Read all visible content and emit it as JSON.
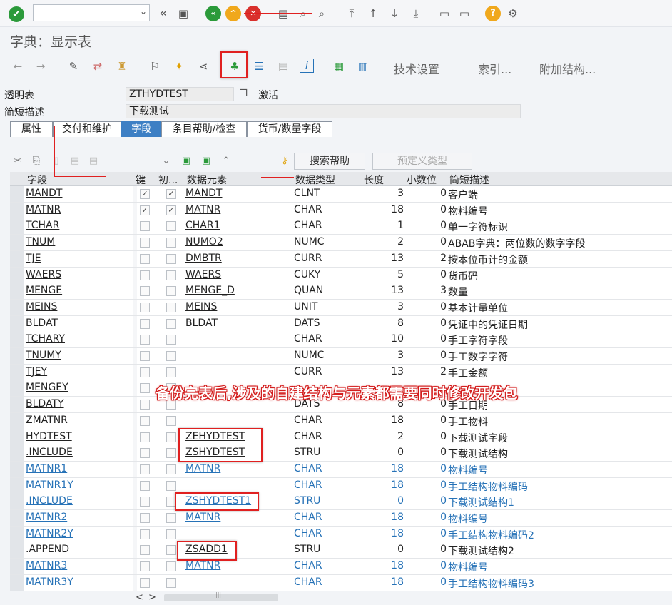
{
  "window": {
    "title": "字典：显示表"
  },
  "toolbar1": {
    "icons": [
      "check-icon",
      "back-icon",
      "save-icon",
      "green-back-icon",
      "up-icon",
      "cancel-icon",
      "print-icon",
      "find-icon",
      "find-next-icon",
      "page-first-icon",
      "page-prev-icon",
      "page-next-icon",
      "page-last-icon",
      "new-session-icon",
      "shortcut-icon",
      "help-icon",
      "settings-icon"
    ]
  },
  "toolbar2": {
    "tech_settings": "技术设置",
    "index": "索引...",
    "append_structure": "附加结构..."
  },
  "header": {
    "table_label": "透明表",
    "table_value": "ZTHYDTEST",
    "status": "激活",
    "desc_label": "简短描述",
    "desc_value": "下载测试"
  },
  "tabs": [
    "属性",
    "交付和维护",
    "字段",
    "条目帮助/检查",
    "货币/数量字段"
  ],
  "table_toolbar": {
    "search_help": "搜索帮助",
    "predefined_type": "预定义类型"
  },
  "columns": [
    "字段",
    "键",
    "初...",
    "数据元素",
    "数据类型",
    "长度",
    "小数位",
    "简短描述"
  ],
  "rows": [
    {
      "field": "MANDT",
      "key": true,
      "init": true,
      "elem": "MANDT",
      "type": "CLNT",
      "len": "3",
      "dec": "0",
      "desc": "客户端",
      "blue": false,
      "ufield": true,
      "uelem": true
    },
    {
      "field": "MATNR",
      "key": true,
      "init": true,
      "elem": "MATNR",
      "type": "CHAR",
      "len": "18",
      "dec": "0",
      "desc": "物料编号",
      "blue": false,
      "ufield": true,
      "uelem": true
    },
    {
      "field": "TCHAR",
      "key": false,
      "init": false,
      "elem": "CHAR1",
      "type": "CHAR",
      "len": "1",
      "dec": "0",
      "desc": "单一字符标识",
      "blue": false,
      "ufield": true,
      "uelem": true
    },
    {
      "field": "TNUM",
      "key": false,
      "init": false,
      "elem": "NUMO2",
      "type": "NUMC",
      "len": "2",
      "dec": "0",
      "desc": "ABAB字典：两位数的数字字段",
      "blue": false,
      "ufield": true,
      "uelem": true
    },
    {
      "field": "TJE",
      "key": false,
      "init": false,
      "elem": "DMBTR",
      "type": "CURR",
      "len": "13",
      "dec": "2",
      "desc": "按本位币计的金额",
      "blue": false,
      "ufield": true,
      "uelem": true
    },
    {
      "field": "WAERS",
      "key": false,
      "init": false,
      "elem": "WAERS",
      "type": "CUKY",
      "len": "5",
      "dec": "0",
      "desc": "货币码",
      "blue": false,
      "ufield": true,
      "uelem": true
    },
    {
      "field": "MENGE",
      "key": false,
      "init": false,
      "elem": "MENGE_D",
      "type": "QUAN",
      "len": "13",
      "dec": "3",
      "desc": "数量",
      "blue": false,
      "ufield": true,
      "uelem": true
    },
    {
      "field": "MEINS",
      "key": false,
      "init": false,
      "elem": "MEINS",
      "type": "UNIT",
      "len": "3",
      "dec": "0",
      "desc": "基本计量单位",
      "blue": false,
      "ufield": true,
      "uelem": true
    },
    {
      "field": "BLDAT",
      "key": false,
      "init": false,
      "elem": "BLDAT",
      "type": "DATS",
      "len": "8",
      "dec": "0",
      "desc": "凭证中的凭证日期",
      "blue": false,
      "ufield": true,
      "uelem": true
    },
    {
      "field": "TCHARY",
      "key": false,
      "init": false,
      "elem": "",
      "type": "CHAR",
      "len": "10",
      "dec": "0",
      "desc": "手工字符字段",
      "blue": false,
      "ufield": true,
      "uelem": false
    },
    {
      "field": "TNUMY",
      "key": false,
      "init": false,
      "elem": "",
      "type": "NUMC",
      "len": "3",
      "dec": "0",
      "desc": "手工数字字符",
      "blue": false,
      "ufield": true,
      "uelem": false
    },
    {
      "field": "TJEY",
      "key": false,
      "init": false,
      "elem": "",
      "type": "CURR",
      "len": "13",
      "dec": "2",
      "desc": "手工金额",
      "blue": false,
      "ufield": true,
      "uelem": false
    },
    {
      "field": "MENGEY",
      "key": false,
      "init": false,
      "elem": "",
      "type": "",
      "len": "",
      "dec": "",
      "desc": "",
      "blue": false,
      "ufield": true,
      "uelem": false
    },
    {
      "field": "BLDATY",
      "key": false,
      "init": false,
      "elem": "",
      "type": "DATS",
      "len": "8",
      "dec": "0",
      "desc": "手工日期",
      "blue": false,
      "ufield": true,
      "uelem": false
    },
    {
      "field": "ZMATNR",
      "key": false,
      "init": false,
      "elem": "",
      "type": "CHAR",
      "len": "18",
      "dec": "0",
      "desc": "手工物料",
      "blue": false,
      "ufield": true,
      "uelem": false
    },
    {
      "field": "HYDTEST",
      "key": false,
      "init": false,
      "elem": "ZEHYDTEST",
      "type": "CHAR",
      "len": "2",
      "dec": "0",
      "desc": "下载测试字段",
      "blue": false,
      "ufield": true,
      "uelem": true
    },
    {
      "field": ".INCLUDE",
      "key": false,
      "init": false,
      "elem": "ZSHYDTEST",
      "type": "STRU",
      "len": "0",
      "dec": "0",
      "desc": "下载测试结构",
      "blue": false,
      "ufield": true,
      "uelem": true
    },
    {
      "field": "MATNR1",
      "key": false,
      "init": false,
      "elem": "MATNR",
      "type": "CHAR",
      "len": "18",
      "dec": "0",
      "desc": "物料编号",
      "blue": true,
      "ufield": true,
      "uelem": true
    },
    {
      "field": "MATNR1Y",
      "key": false,
      "init": false,
      "elem": "",
      "type": "CHAR",
      "len": "18",
      "dec": "0",
      "desc": "手工结构物料编码",
      "blue": true,
      "ufield": true,
      "uelem": false
    },
    {
      "field": ".INCLUDE",
      "key": false,
      "init": false,
      "elem": "ZSHYDTEST1",
      "type": "STRU",
      "len": "0",
      "dec": "0",
      "desc": "下载测试结构1",
      "blue": true,
      "ufield": true,
      "uelem": true
    },
    {
      "field": "MATNR2",
      "key": false,
      "init": false,
      "elem": "MATNR",
      "type": "CHAR",
      "len": "18",
      "dec": "0",
      "desc": "物料编号",
      "blue": true,
      "ufield": true,
      "uelem": true
    },
    {
      "field": "MATNR2Y",
      "key": false,
      "init": false,
      "elem": "",
      "type": "CHAR",
      "len": "18",
      "dec": "0",
      "desc": "手工结构物料编码2",
      "blue": true,
      "ufield": true,
      "uelem": false
    },
    {
      "field": ".APPEND",
      "key": false,
      "init": false,
      "elem": "ZSADD1",
      "type": "STRU",
      "len": "0",
      "dec": "0",
      "desc": "下载测试结构2",
      "blue": false,
      "ufield": false,
      "uelem": true
    },
    {
      "field": "MATNR3",
      "key": false,
      "init": false,
      "elem": "MATNR",
      "type": "CHAR",
      "len": "18",
      "dec": "0",
      "desc": "物料编号",
      "blue": true,
      "ufield": true,
      "uelem": true
    },
    {
      "field": "MATNR3Y",
      "key": false,
      "init": false,
      "elem": "",
      "type": "CHAR",
      "len": "18",
      "dec": "0",
      "desc": "手工结构物料编码3",
      "blue": true,
      "ufield": true,
      "uelem": false
    }
  ],
  "annotation": {
    "note": "备份完表后,涉及的自建结构与元素都需要同时修改开发包"
  },
  "scroll": {
    "left": "<",
    "right": ">",
    "grip": "|||"
  }
}
